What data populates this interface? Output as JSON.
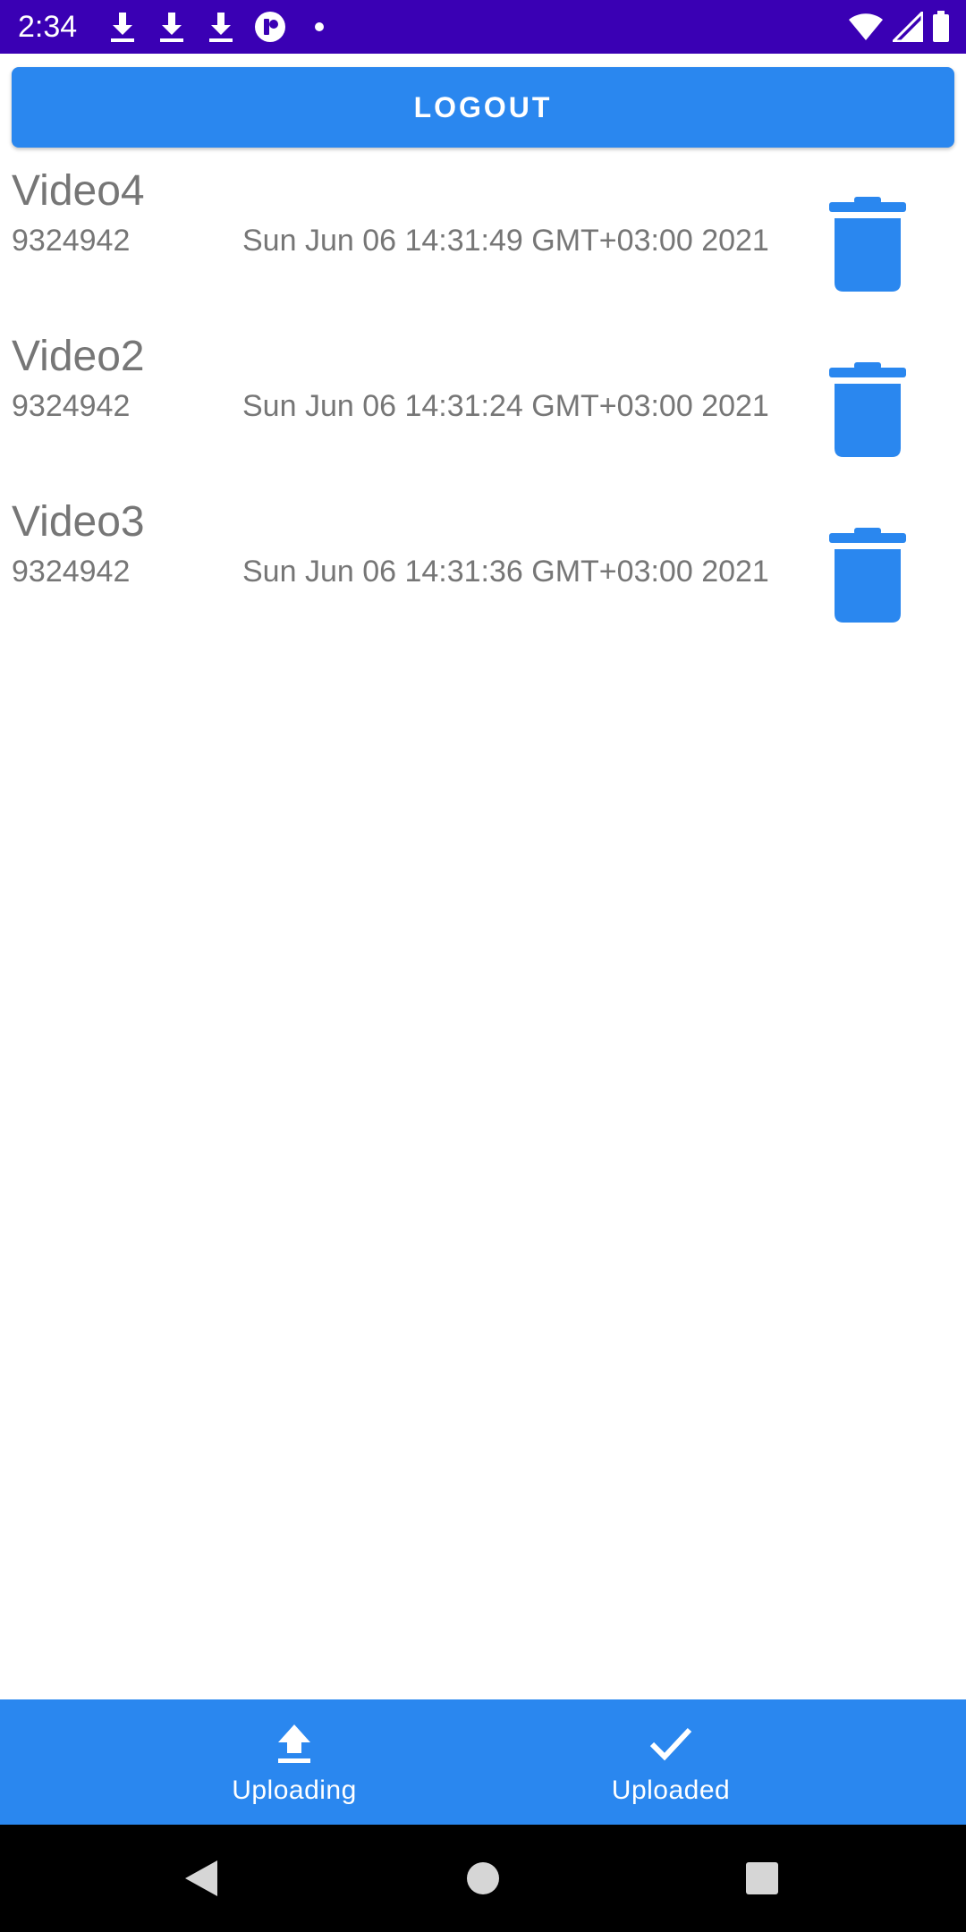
{
  "status_bar": {
    "time": "2:34",
    "background": "#3a00b4"
  },
  "logout_button": {
    "label": "LOGOUT",
    "color": "#2a87ef"
  },
  "videos": [
    {
      "title": "Video4",
      "size": "9324942",
      "date": "Sun Jun 06 14:31:49 GMT+03:00 2021"
    },
    {
      "title": "Video2",
      "size": "9324942",
      "date": "Sun Jun 06 14:31:24 GMT+03:00 2021"
    },
    {
      "title": "Video3",
      "size": "9324942",
      "date": "Sun Jun 06 14:31:36 GMT+03:00 2021"
    }
  ],
  "bottom_nav": {
    "items": [
      {
        "label": "Uploading",
        "icon": "upload-icon"
      },
      {
        "label": "Uploaded",
        "icon": "check-icon"
      }
    ]
  },
  "colors": {
    "accent": "#2a87ef",
    "text_secondary": "#767676"
  }
}
